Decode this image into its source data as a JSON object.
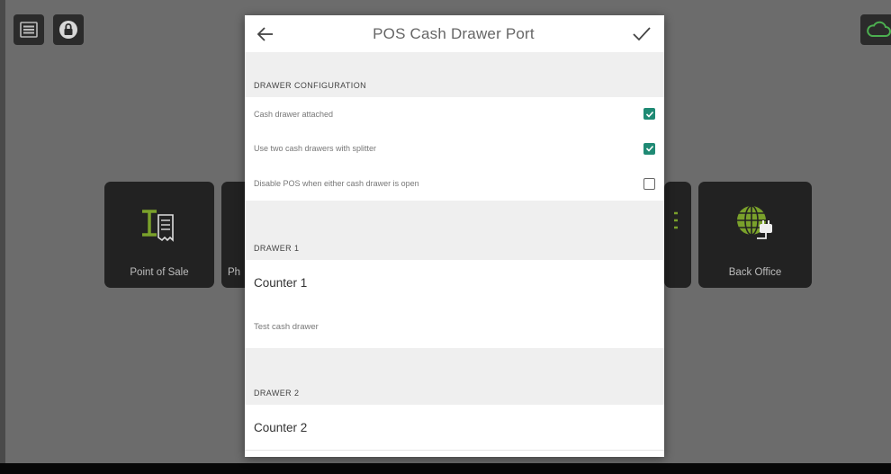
{
  "dialog": {
    "title": "POS Cash Drawer Port",
    "sections": {
      "config": {
        "header": "DRAWER CONFIGURATION",
        "items": [
          {
            "label": "Cash drawer attached",
            "checked": true
          },
          {
            "label": "Use two cash drawers with splitter",
            "checked": true
          },
          {
            "label": "Disable POS when either cash drawer is open",
            "checked": false
          }
        ]
      },
      "drawer1": {
        "header": "DRAWER 1",
        "name": "Counter 1",
        "action": "Test cash drawer"
      },
      "drawer2": {
        "header": "DRAWER 2",
        "name": "Counter 2"
      }
    }
  },
  "tiles": {
    "point_of_sale": "Point of Sale",
    "partial": "Ph",
    "back_office": "Back Office"
  },
  "icons": {
    "menu": "menu-icon",
    "lock": "lock-icon",
    "cloud": "cloud-icon",
    "back": "back-arrow-icon",
    "confirm": "checkmark-icon",
    "pos": "register-receipt-icon",
    "back_office": "globe-plug-icon"
  },
  "colors": {
    "accent": "#1f8a74",
    "brand_green": "#7aa12b",
    "cloud_green": "#4caf50"
  }
}
